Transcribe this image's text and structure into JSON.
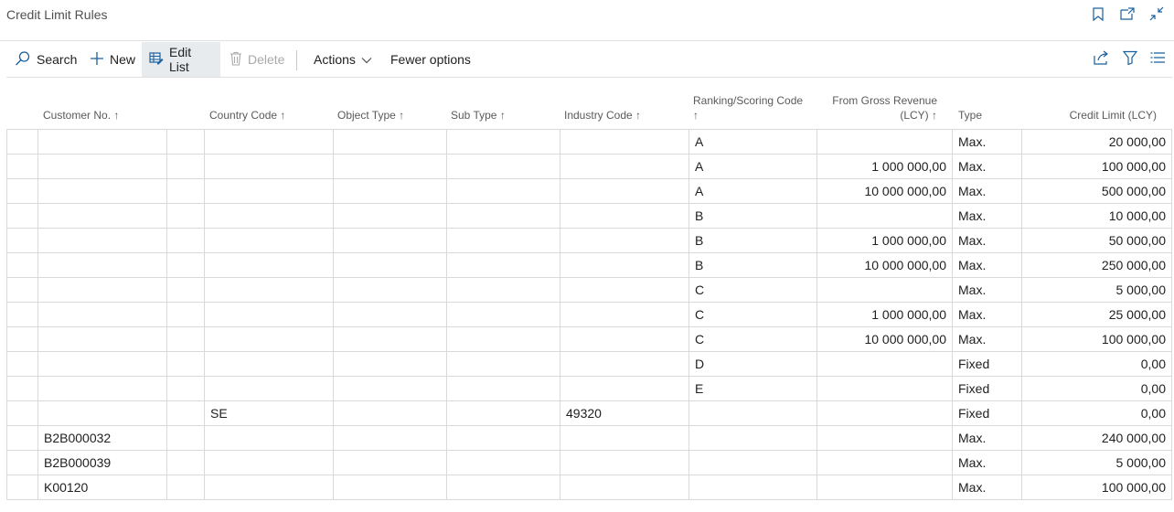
{
  "page": {
    "title": "Credit Limit Rules"
  },
  "title_icons": [
    "bookmark-icon",
    "open-new-window-icon",
    "collapse-icon"
  ],
  "toolbar": {
    "search_label": "Search",
    "new_label": "New",
    "edit_list_label": "Edit List",
    "delete_label": "Delete",
    "actions_label": "Actions",
    "fewer_options_label": "Fewer options",
    "right_icons": [
      "share-icon",
      "filter-icon",
      "list-view-icon"
    ]
  },
  "columns": {
    "customer_no": "Customer No. ↑",
    "country_code": "Country Code ↑",
    "object_type": "Object Type ↑",
    "sub_type": "Sub Type ↑",
    "industry_code": "Industry Code ↑",
    "ranking_line1": "Ranking/Scoring Code",
    "ranking_line2": "↑",
    "revenue_line1": "From Gross Revenue",
    "revenue_line2": "(LCY) ↑",
    "type": "Type",
    "credit_limit": "Credit Limit (LCY)"
  },
  "rows": [
    {
      "customer": "",
      "country": "",
      "object": "",
      "sub": "",
      "industry": "",
      "ranking": "A",
      "revenue": "",
      "type": "Max.",
      "limit": "20 000,00"
    },
    {
      "customer": "",
      "country": "",
      "object": "",
      "sub": "",
      "industry": "",
      "ranking": "A",
      "revenue": "1 000 000,00",
      "type": "Max.",
      "limit": "100 000,00"
    },
    {
      "customer": "",
      "country": "",
      "object": "",
      "sub": "",
      "industry": "",
      "ranking": "A",
      "revenue": "10 000 000,00",
      "type": "Max.",
      "limit": "500 000,00"
    },
    {
      "customer": "",
      "country": "",
      "object": "",
      "sub": "",
      "industry": "",
      "ranking": "B",
      "revenue": "",
      "type": "Max.",
      "limit": "10 000,00"
    },
    {
      "customer": "",
      "country": "",
      "object": "",
      "sub": "",
      "industry": "",
      "ranking": "B",
      "revenue": "1 000 000,00",
      "type": "Max.",
      "limit": "50 000,00"
    },
    {
      "customer": "",
      "country": "",
      "object": "",
      "sub": "",
      "industry": "",
      "ranking": "B",
      "revenue": "10 000 000,00",
      "type": "Max.",
      "limit": "250 000,00"
    },
    {
      "customer": "",
      "country": "",
      "object": "",
      "sub": "",
      "industry": "",
      "ranking": "C",
      "revenue": "",
      "type": "Max.",
      "limit": "5 000,00"
    },
    {
      "customer": "",
      "country": "",
      "object": "",
      "sub": "",
      "industry": "",
      "ranking": "C",
      "revenue": "1 000 000,00",
      "type": "Max.",
      "limit": "25 000,00"
    },
    {
      "customer": "",
      "country": "",
      "object": "",
      "sub": "",
      "industry": "",
      "ranking": "C",
      "revenue": "10 000 000,00",
      "type": "Max.",
      "limit": "100 000,00"
    },
    {
      "customer": "",
      "country": "",
      "object": "",
      "sub": "",
      "industry": "",
      "ranking": "D",
      "revenue": "",
      "type": "Fixed",
      "limit": "0,00"
    },
    {
      "customer": "",
      "country": "",
      "object": "",
      "sub": "",
      "industry": "",
      "ranking": "E",
      "revenue": "",
      "type": "Fixed",
      "limit": "0,00"
    },
    {
      "customer": "",
      "country": "SE",
      "object": "",
      "sub": "",
      "industry": "49320",
      "ranking": "",
      "revenue": "",
      "type": "Fixed",
      "limit": "0,00"
    },
    {
      "customer": "B2B000032",
      "country": "",
      "object": "",
      "sub": "",
      "industry": "",
      "ranking": "",
      "revenue": "",
      "type": "Max.",
      "limit": "240 000,00"
    },
    {
      "customer": "B2B000039",
      "country": "",
      "object": "",
      "sub": "",
      "industry": "",
      "ranking": "",
      "revenue": "",
      "type": "Max.",
      "limit": "5 000,00"
    },
    {
      "customer": "K00120",
      "country": "",
      "object": "",
      "sub": "",
      "industry": "",
      "ranking": "",
      "revenue": "",
      "type": "Max.",
      "limit": "100 000,00"
    }
  ]
}
